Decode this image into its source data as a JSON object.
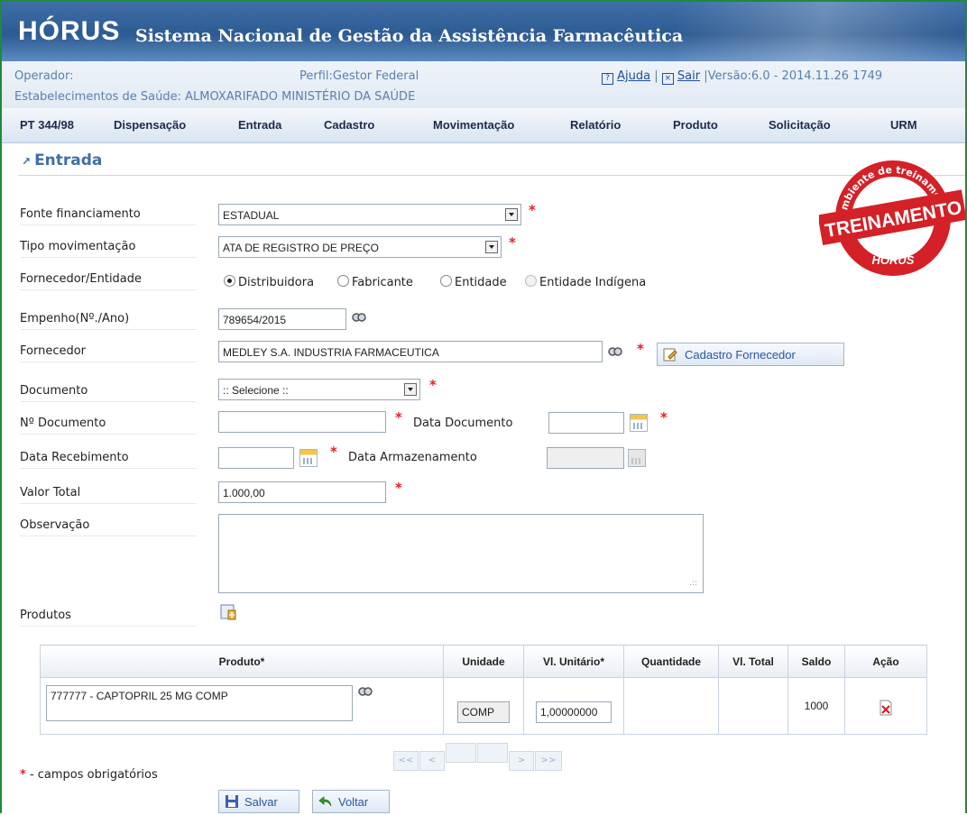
{
  "header": {
    "logo": "HÓRUS",
    "subtitle": "Sistema Nacional de Gestão da Assistência Farmacêutica"
  },
  "info": {
    "operador": "Operador:",
    "perfil": "Perfil:Gestor Federal",
    "help_label": "Ajuda",
    "separator": "|",
    "exit_label": "Sair",
    "version": "|Versão:6.0 - 2014.11.26 1749",
    "estabelecimento": "Estabelecimentos de Saúde: ALMOXARIFADO MINISTÉRIO DA SAÚDE"
  },
  "menu": [
    "PT 344/98",
    "Dispensação",
    "Entrada",
    "Cadastro",
    "Movimentação",
    "Relatório",
    "Produto",
    "Solicitação",
    "URM"
  ],
  "page_title": "Entrada",
  "stamp": {
    "top_text": "Ambiente de treinamento",
    "main_text": "TREINAMENTO",
    "bottom_text": "HÓRUS"
  },
  "form": {
    "fonte_label": "Fonte financiamento",
    "fonte_value": "ESTADUAL",
    "tipo_label": "Tipo movimentação",
    "tipo_value": "ATA DE REGISTRO DE PREÇO",
    "fornecedor_entidade_label": "Fornecedor/Entidade",
    "radio_options": [
      "Distribuidora",
      "Fabricante",
      "Entidade",
      "Entidade Indígena"
    ],
    "radio_selected": "Distribuidora",
    "empenho_label": "Empenho(Nº./Ano)",
    "empenho_value": "789654/2015",
    "fornecedor_label": "Fornecedor",
    "fornecedor_value": "MEDLEY S.A. INDUSTRIA FARMACEUTICA",
    "cadastro_fornecedor_button": "Cadastro Fornecedor",
    "documento_label": "Documento",
    "documento_value": ":: Selecione ::",
    "num_documento_label": "Nº Documento",
    "num_documento_value": "",
    "data_documento_label": "Data Documento",
    "data_documento_value": "",
    "data_recebimento_label": "Data Recebimento",
    "data_recebimento_value": "",
    "data_armazenamento_label": "Data Armazenamento",
    "data_armazenamento_value": "",
    "valor_total_label": "Valor Total",
    "valor_total_value": "1.000,00",
    "observacao_label": "Observação",
    "observacao_value": "",
    "produtos_label": "Produtos",
    "required_marker": "*"
  },
  "table": {
    "headers": [
      "Produto*",
      "Unidade",
      "Vl. Unitário*",
      "Quantidade",
      "Vl. Total",
      "Saldo",
      "Ação"
    ],
    "rows": [
      {
        "produto": "777777 - CAPTOPRIL  25 MG  COMP",
        "unidade": "COMP",
        "vl_unitario": "1,00000000",
        "quantidade": "",
        "vl_total": "",
        "saldo": "1000"
      }
    ]
  },
  "pager": [
    "<<",
    "<",
    "",
    "",
    ">",
    ">>"
  ],
  "footer": {
    "required_star": "*",
    "required_note": " - campos obrigatórios",
    "save_button": "Salvar",
    "back_button": "Voltar"
  },
  "colors": {
    "banner": "#2d5a92",
    "accent_blue": "#3f6fa8",
    "required_red": "#e0202a",
    "frame_green": "#1e8a3a",
    "stamp_red": "#d42027"
  }
}
